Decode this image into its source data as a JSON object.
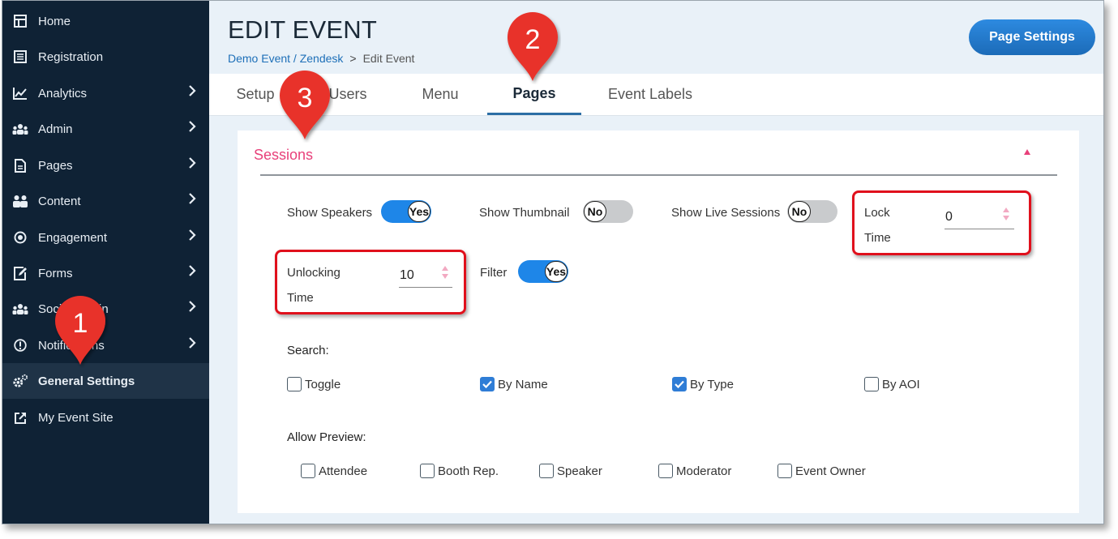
{
  "sidebar": {
    "items": [
      {
        "label": "Home",
        "icon": "table-icon",
        "chevron": false
      },
      {
        "label": "Registration",
        "icon": "list-icon",
        "chevron": false
      },
      {
        "label": "Analytics",
        "icon": "chart-icon",
        "chevron": true
      },
      {
        "label": "Admin",
        "icon": "users-icon",
        "chevron": true
      },
      {
        "label": "Pages",
        "icon": "document-icon",
        "chevron": true
      },
      {
        "label": "Content",
        "icon": "people-icon",
        "chevron": true
      },
      {
        "label": "Engagement",
        "icon": "target-icon",
        "chevron": true
      },
      {
        "label": "Forms",
        "icon": "edit-icon",
        "chevron": true
      },
      {
        "label": "Social Admin",
        "icon": "users-icon",
        "chevron": true
      },
      {
        "label": "Notifications",
        "icon": "alert-icon",
        "chevron": true
      },
      {
        "label": "General Settings",
        "icon": "gears-icon",
        "chevron": false,
        "active": true
      },
      {
        "label": "My Event Site",
        "icon": "external-link-icon",
        "chevron": false
      }
    ]
  },
  "header": {
    "title": "EDIT EVENT",
    "breadcrumb_link": "Demo Event / Zendesk",
    "breadcrumb_sep": ">",
    "breadcrumb_current": "Edit Event",
    "page_settings_label": "Page Settings"
  },
  "tabs": [
    {
      "label": "Setup"
    },
    {
      "label": "Users"
    },
    {
      "label": "Menu"
    },
    {
      "label": "Pages",
      "active": true
    },
    {
      "label": "Event Labels"
    }
  ],
  "section": {
    "title": "Sessions",
    "show_speakers": {
      "label": "Show Speakers",
      "value": "Yes"
    },
    "show_thumbnail": {
      "label": "Show Thumbnail",
      "value": "No"
    },
    "show_live_sessions": {
      "label": "Show Live Sessions",
      "value": "No"
    },
    "lock_time": {
      "label_1": "Lock",
      "label_2": "Time",
      "value": "0"
    },
    "unlocking_time": {
      "label_1": "Unlocking",
      "label_2": "Time",
      "value": "10"
    },
    "filter": {
      "label": "Filter",
      "value": "Yes"
    },
    "search": {
      "heading": "Search:",
      "options": [
        {
          "label": "Toggle",
          "checked": false
        },
        {
          "label": "By Name",
          "checked": true
        },
        {
          "label": "By Type",
          "checked": true
        },
        {
          "label": "By AOI",
          "checked": false
        }
      ]
    },
    "allow_preview": {
      "heading": "Allow Preview:",
      "options": [
        {
          "label": "Attendee",
          "checked": false
        },
        {
          "label": "Booth Rep.",
          "checked": false
        },
        {
          "label": "Speaker",
          "checked": false
        },
        {
          "label": "Moderator",
          "checked": false
        },
        {
          "label": "Event Owner",
          "checked": false
        }
      ]
    }
  },
  "markers": [
    "1",
    "2",
    "3"
  ],
  "colors": {
    "sidebar_bg": "#0f2235",
    "accent_blue": "#1e86e8",
    "section_pink": "#e8407a",
    "highlight_red": "#e0101c",
    "marker_red": "#e8312a"
  }
}
